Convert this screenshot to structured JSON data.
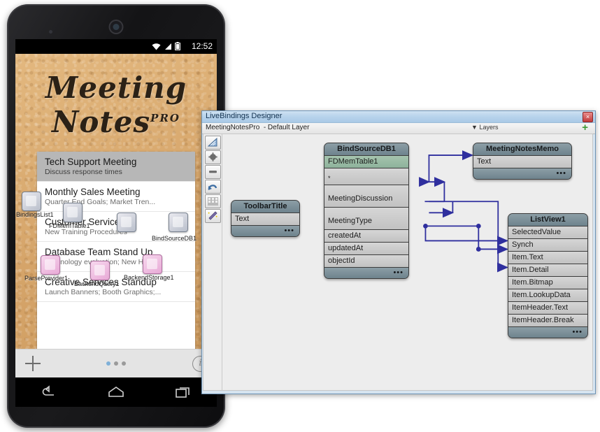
{
  "phone": {
    "statusbar": {
      "time": "12:52",
      "icons": [
        "wifi-icon",
        "signal-icon",
        "battery-icon"
      ]
    },
    "app": {
      "title": "Meeting Notes",
      "title_badge": "PRO"
    },
    "list": [
      {
        "title": "Tech Support Meeting",
        "detail": "Discuss response times",
        "selected": true
      },
      {
        "title": "Monthly Sales Meeting",
        "detail": "Quarter End Goals; Market Tren...",
        "selected": false
      },
      {
        "title": "Customer Service",
        "detail": "New Training Procedures",
        "selected": false
      },
      {
        "title": "Database Team Stand Up",
        "detail": "Technology evaluation; New Hires",
        "selected": false
      },
      {
        "title": "Creative Services Standup",
        "detail": "Launch Banners; Booth Graphics;...",
        "selected": false
      }
    ],
    "bottombar": {
      "add_label": "+",
      "info_label": "i",
      "page_dots": 3,
      "active_dot": 0
    },
    "navbar": [
      "back-icon",
      "home-icon",
      "recents-icon"
    ],
    "components": [
      {
        "name": "BindingsList1"
      },
      {
        "name": "FDMemTable1"
      },
      {
        "name": "BindSourceDB1"
      },
      {
        "name": "ParseProvider1"
      },
      {
        "name": "BackendQuery1"
      },
      {
        "name": "BackendStorage1"
      }
    ]
  },
  "livebindings": {
    "window_title": "LiveBindings Designer",
    "close_label": "×",
    "project": "MeetingNotesPro",
    "layer": "- Default Layer",
    "layers_label": "Layers",
    "layers_caret": "▼",
    "add_layer_label": "+",
    "toolbar": [
      {
        "name": "select-all-visible-icon"
      },
      {
        "name": "zoom-in-icon"
      },
      {
        "name": "zoom-out-icon"
      },
      {
        "name": "undo-icon"
      },
      {
        "name": "grid-icon"
      },
      {
        "name": "wand-icon"
      }
    ],
    "nodes": [
      {
        "id": "toolbartitle",
        "title": "ToolbarTitle",
        "rows": [
          {
            "label": "Text",
            "type": "normal"
          }
        ],
        "ellipsis": "•••"
      },
      {
        "id": "bindsourcedb1",
        "title": "BindSourceDB1",
        "rows": [
          {
            "label": "FDMemTable1",
            "type": "green"
          },
          {
            "label": "*",
            "type": "star"
          },
          {
            "label": "MeetingDiscussion",
            "type": "tall"
          },
          {
            "label": "MeetingType",
            "type": "tall"
          },
          {
            "label": "createdAt",
            "type": "normal"
          },
          {
            "label": "updatedAt",
            "type": "normal"
          },
          {
            "label": "objectId",
            "type": "normal"
          }
        ],
        "ellipsis": "•••"
      },
      {
        "id": "meetingnotesmemo",
        "title": "MeetingNotesMemo",
        "rows": [
          {
            "label": "Text",
            "type": "normal"
          }
        ],
        "ellipsis": "•••"
      },
      {
        "id": "listview1",
        "title": "ListView1",
        "rows": [
          {
            "label": "SelectedValue",
            "type": "normal"
          },
          {
            "label": "Synch",
            "type": "normal"
          },
          {
            "label": "Item.Text",
            "type": "normal"
          },
          {
            "label": "Item.Detail",
            "type": "normal"
          },
          {
            "label": "Item.Bitmap",
            "type": "normal"
          },
          {
            "label": "Item.LookupData",
            "type": "normal"
          },
          {
            "label": "ItemHeader.Text",
            "type": "normal"
          },
          {
            "label": "ItemHeader.Break",
            "type": "normal"
          }
        ],
        "ellipsis": "•••"
      }
    ],
    "wire_color": "#2f2f9e"
  }
}
